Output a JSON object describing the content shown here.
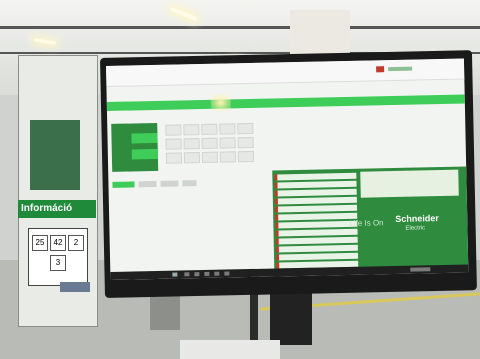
{
  "scene": {
    "board_heading": "Információ",
    "calendar": {
      "top_left": "25",
      "top_mid": "42",
      "top_right": "2",
      "bottom": "3"
    },
    "screen": {
      "slogan": "Life Is On",
      "brand_name": "Schneider",
      "brand_sub": "Electric"
    }
  },
  "colors": {
    "brand_green": "#3dcd58",
    "panel_green": "#2f8c3f",
    "board_green": "#1f8a3a"
  }
}
